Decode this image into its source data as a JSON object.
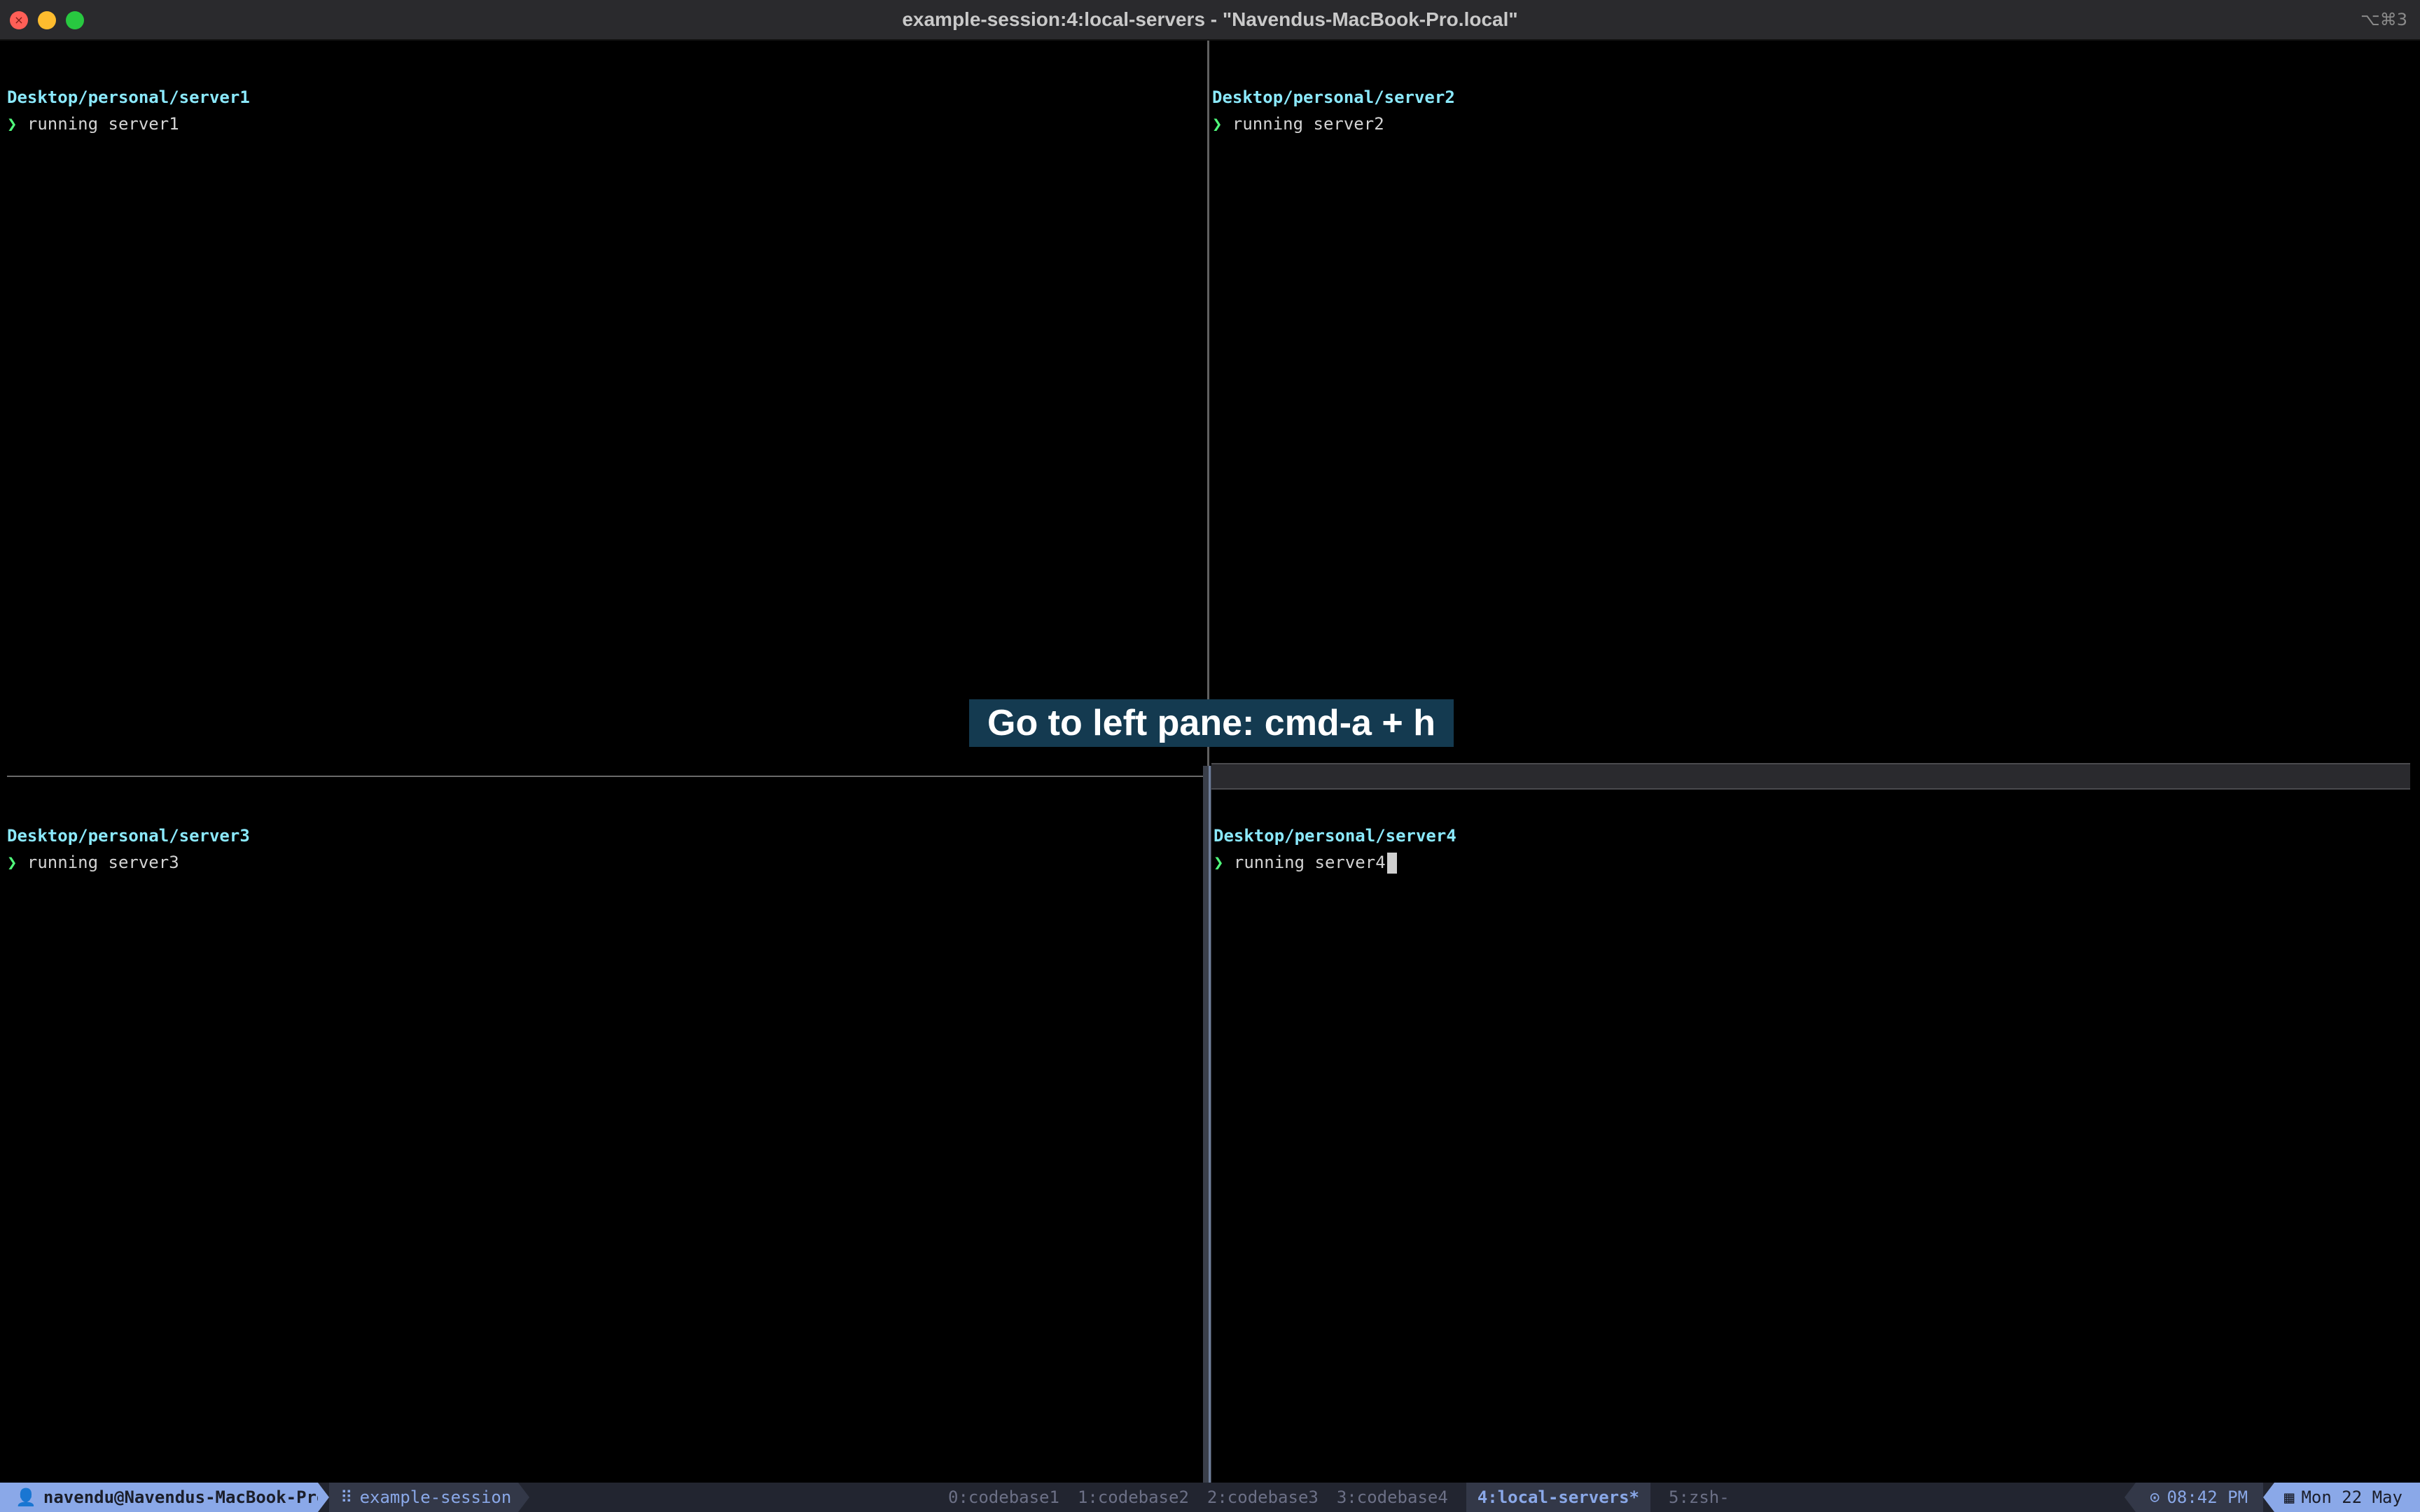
{
  "window": {
    "title": "example-session:4:local-servers - \"Navendus-MacBook-Pro.local\"",
    "shortcut": "⌥⌘3",
    "close_glyph": "×"
  },
  "panes": [
    {
      "path": "Desktop/personal/server1",
      "prompt": "❯",
      "command": " running server1"
    },
    {
      "path": "Desktop/personal/server2",
      "prompt": "❯",
      "command": " running server2"
    },
    {
      "path": "Desktop/personal/server3",
      "prompt": "❯",
      "command": " running server3"
    },
    {
      "path": "Desktop/personal/server4",
      "prompt": "❯",
      "command": " running server4"
    }
  ],
  "overlay": {
    "text": "Go to left pane: cmd-a + h"
  },
  "statusbar": {
    "user_icon": "👤",
    "user": "navendu@Navendus-MacBook-Pro",
    "session_icon": "⠿",
    "session": "example-session",
    "windows": [
      {
        "label": "0:codebase1",
        "active": false
      },
      {
        "label": "1:codebase2",
        "active": false
      },
      {
        "label": "2:codebase3",
        "active": false
      },
      {
        "label": "3:codebase4",
        "active": false
      },
      {
        "label": "4:local-servers*",
        "active": true
      },
      {
        "label": "5:zsh-",
        "active": false
      }
    ],
    "time_icon": "⊙",
    "time": "08:42 PM",
    "date_icon": "▦",
    "date": "Mon 22 May"
  },
  "colors": {
    "path": "#8be9fd",
    "prompt": "#50fa7b",
    "accent": "#8aa8e8",
    "overlay_bg": "#143a50"
  }
}
